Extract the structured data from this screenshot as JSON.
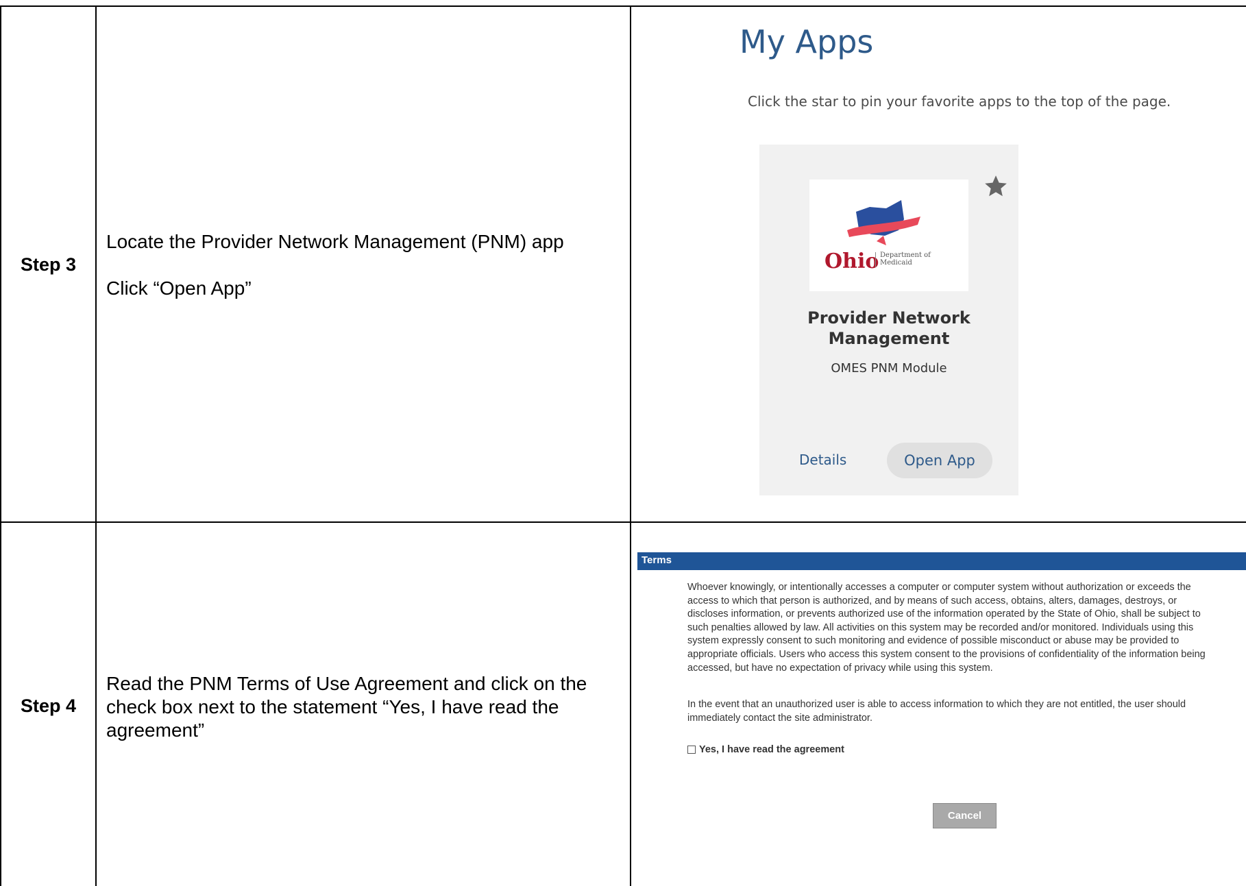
{
  "rows": [
    {
      "step": "Step 3",
      "instructions": [
        "Locate the Provider Network Management (PNM) app",
        "Click “Open App”"
      ]
    },
    {
      "step": "Step 4",
      "instructions": [
        "Read the PNM Terms of Use Agreement and click on the check box next to the statement “Yes, I have read the agreement”"
      ]
    }
  ],
  "my_apps": {
    "title": "My Apps",
    "subtitle": "Click the star to pin your favorite apps to the top of the page.",
    "card": {
      "logo_text": "Ohio",
      "logo_subtext_1": "Department of",
      "logo_subtext_2": "Medicaid",
      "name_line1": "Provider Network",
      "name_line2": "Management",
      "description": "OMES PNM Module",
      "details_label": "Details",
      "open_label": "Open App",
      "star_icon": "star-icon"
    }
  },
  "terms": {
    "header": "Terms",
    "paragraph1": "Whoever knowingly, or intentionally accesses a computer or computer system without authorization or exceeds the access to which that person is authorized, and by means of such access, obtains, alters, damages, destroys, or discloses information, or prevents authorized use of the information operated by the State of Ohio, shall be subject to such penalties allowed by law. All activities on this system may be recorded and/or monitored. Individuals using this system expressly consent to such monitoring and evidence of possible misconduct or abuse may be provided to appropriate officials. Users who access this system consent to the provisions of confidentiality of the information being accessed, but have no expectation of privacy while using this system.",
    "paragraph2": "In the event that an unauthorized user is able to access information to which they are not entitled, the user should immediately contact the site administrator.",
    "checkbox_label": "Yes, I have read the agreement",
    "cancel_label": "Cancel"
  },
  "colors": {
    "header_blue": "#1f5597",
    "title_blue": "#2e5a8a",
    "card_bg": "#f1f1f1",
    "button_grey": "#a9a9a9"
  }
}
